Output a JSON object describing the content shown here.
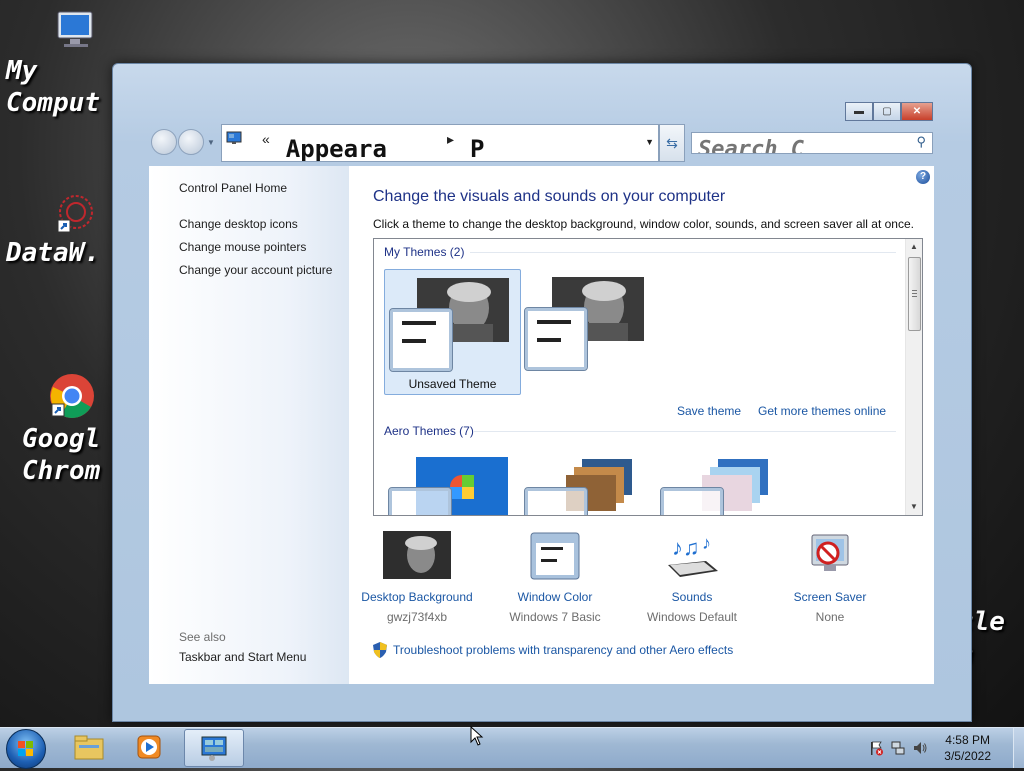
{
  "desktop": {
    "icons": [
      {
        "label": "My\nComput"
      },
      {
        "label": "DataW."
      },
      {
        "label": "Googl\nChrom"
      }
    ],
    "partial_right_label": "cle\nn"
  },
  "window": {
    "address": {
      "crumb1": "Appeara",
      "crumb2": "P",
      "back_marker": "«"
    },
    "search": {
      "placeholder": "Search C"
    },
    "sidebar": {
      "home": "Control Panel Home",
      "links": [
        "Change desktop icons",
        "Change mouse pointers",
        "Change your account picture"
      ],
      "see_also": "See also",
      "see_also_links": [
        "Taskbar and Start Menu"
      ]
    },
    "main": {
      "title": "Change the visuals and sounds on your computer",
      "subtitle": "Click a theme to change the desktop background, window color, sounds, and screen saver all at once.",
      "my_themes_header": "My Themes (2)",
      "themes": [
        {
          "name": "Unsaved Theme",
          "selected": true
        },
        {
          "name": "",
          "selected": false
        }
      ],
      "save_theme": "Save theme",
      "get_more": "Get more themes online",
      "aero_header": "Aero Themes (7)"
    },
    "bottom": [
      {
        "label": "Desktop Background",
        "value": "gwzj73f4xb",
        "icon": "photo-icon"
      },
      {
        "label": "Window Color",
        "value": "Windows 7 Basic",
        "icon": "window-color-icon"
      },
      {
        "label": "Sounds",
        "value": "Windows Default",
        "icon": "music-notes-icon"
      },
      {
        "label": "Screen Saver",
        "value": "None",
        "icon": "no-screensaver-icon"
      }
    ],
    "troubleshoot": "Troubleshoot problems with transparency and other Aero effects"
  },
  "taskbar": {
    "time": "4:58 PM",
    "date": "3/5/2022"
  },
  "colors": {
    "accent_link": "#1b57a4",
    "title": "#1e3287",
    "selection": "#dceaf9"
  }
}
